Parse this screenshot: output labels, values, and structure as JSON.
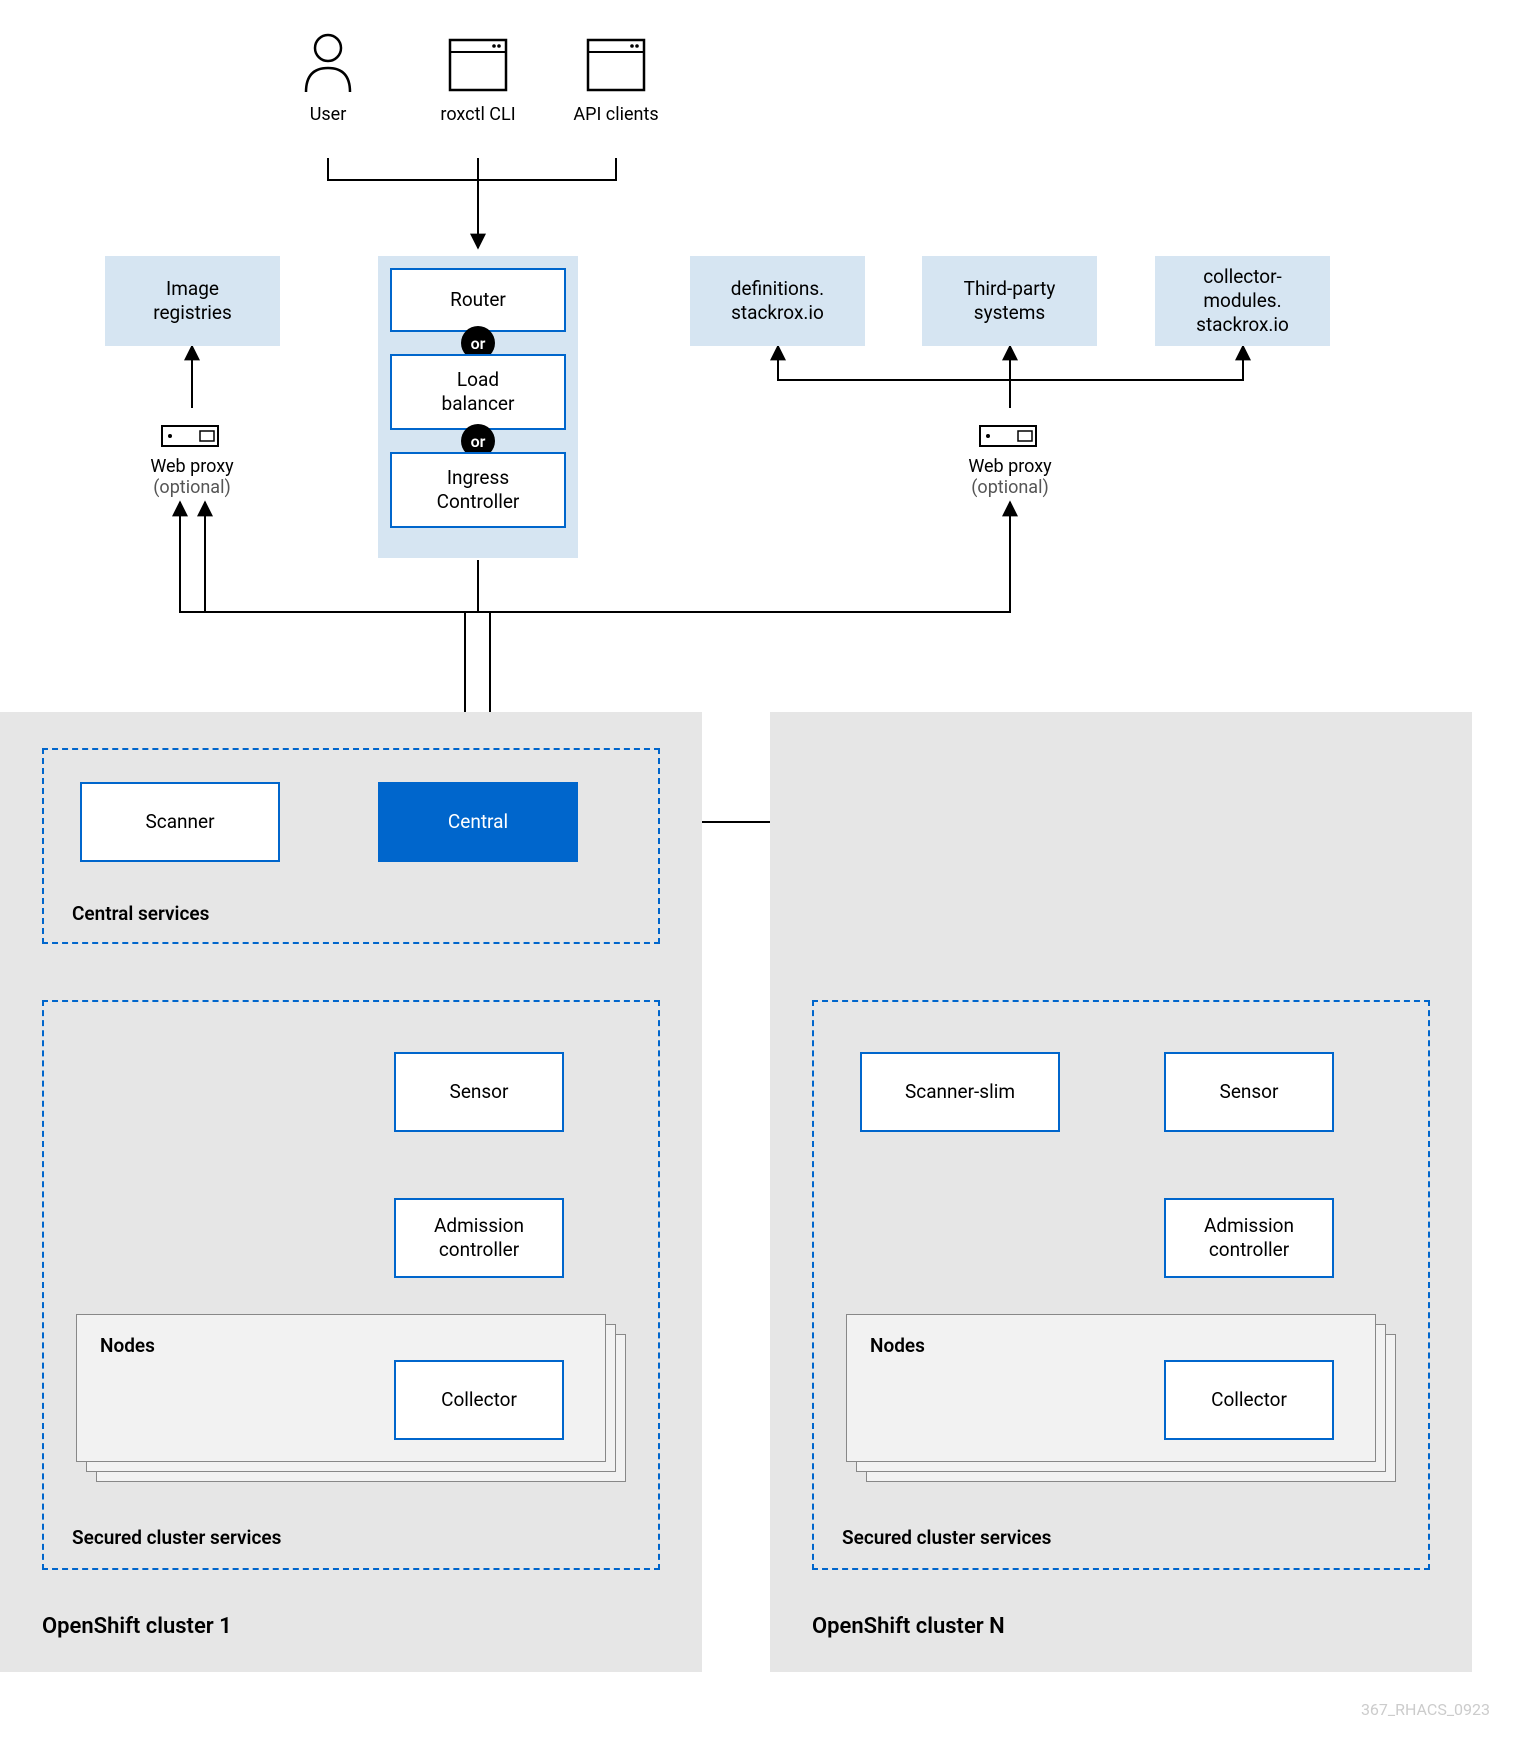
{
  "top": {
    "user": "User",
    "roxctl": "roxctl CLI",
    "api": "API clients"
  },
  "leftcol": {
    "registries": "Image\nregistries",
    "webproxy": "Web proxy",
    "optional": "(optional)"
  },
  "ingress": {
    "router": "Router",
    "lb": "Load\nbalancer",
    "ic": "Ingress\nController",
    "or": "or"
  },
  "rightrow": {
    "defs": "definitions.\nstackrox.io",
    "third": "Third-party\nsystems",
    "coll": "collector-\nmodules.\nstackrox.io",
    "webproxy": "Web proxy",
    "optional": "(optional)"
  },
  "central": {
    "group": "Central services",
    "scanner": "Scanner",
    "central": "Central"
  },
  "secured": {
    "group": "Secured cluster services",
    "sensor": "Sensor",
    "admission": "Admission\ncontroller",
    "nodes": "Nodes",
    "collector": "Collector",
    "scannerslim": "Scanner-slim"
  },
  "clusters": {
    "c1": "OpenShift cluster 1",
    "cn": "OpenShift cluster N"
  },
  "footer": "367_RHACS_0923"
}
